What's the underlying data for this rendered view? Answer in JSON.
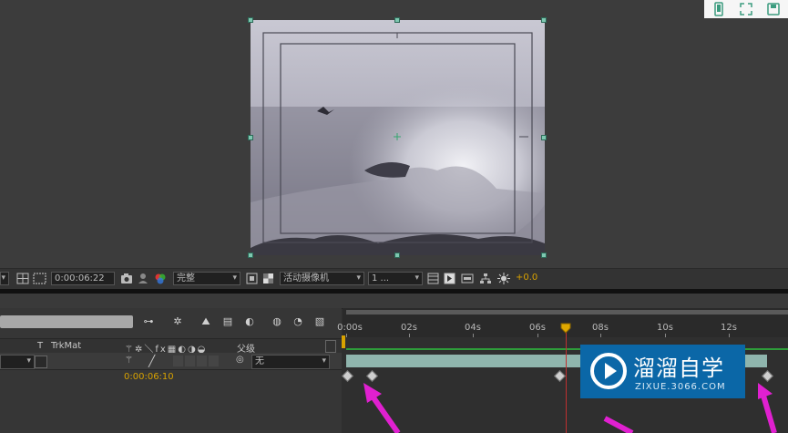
{
  "viewer_bar": {
    "timecode": "0:00:06:22",
    "resolution": "完整",
    "camera": "活动摄像机",
    "views": "1 ...",
    "exposure": "+0.0"
  },
  "timeline": {
    "col_t": "T",
    "col_trkmat": "TrkMat",
    "col_parent": "父级",
    "parent_value": "无",
    "current_time": "0:00:06:10",
    "ruler_labels": [
      "0:00s",
      "02s",
      "04s",
      "06s",
      "08s",
      "10s",
      "12s"
    ]
  },
  "watermark": {
    "title": "溜溜自学",
    "url": "ZIXUE.3066.COM"
  },
  "colors": {
    "accent": "#d8a200",
    "arrow": "#e020d0",
    "watermark_bg": "#0b67a7"
  }
}
